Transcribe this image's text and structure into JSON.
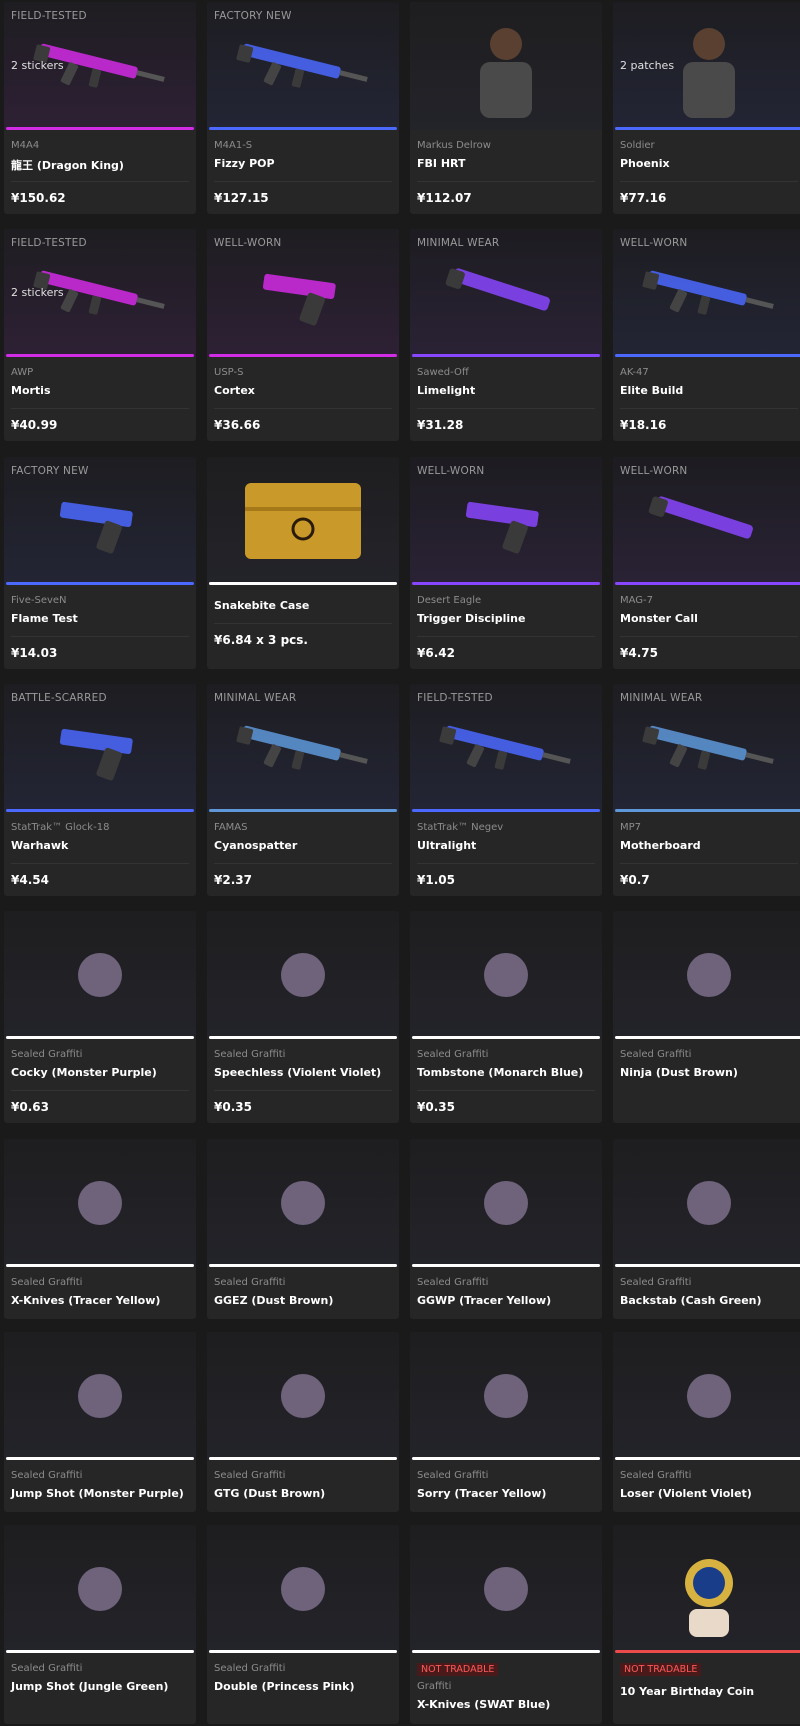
{
  "colors": {
    "pink": "#d32ce6",
    "purple": "#8847ff",
    "blue": "#4b69ff",
    "light_blue": "#5e98d9",
    "white": "#ffffff",
    "red": "#eb4b4b"
  },
  "items": [
    {
      "wear": "FIELD-TESTED",
      "extra": "2 stickers",
      "type": "M4A4",
      "name": "龍王 (Dragon King)",
      "price": "¥150.62",
      "rarity_color": "pink",
      "icon": "rifle-icon"
    },
    {
      "wear": "FACTORY NEW",
      "extra": "",
      "type": "M4A1-S",
      "name": "Fizzy POP",
      "price": "¥127.15",
      "rarity_color": "blue",
      "icon": "rifle-icon"
    },
    {
      "wear": "",
      "extra": "",
      "type": "Markus Delrow",
      "name": "FBI HRT",
      "price": "¥112.07",
      "rarity_color": "none",
      "icon": "agent-icon"
    },
    {
      "wear": "",
      "extra": "2 patches",
      "type": "Soldier",
      "name": "Phoenix",
      "price": "¥77.16",
      "rarity_color": "blue",
      "icon": "agent-icon"
    },
    {
      "wear": "FIELD-TESTED",
      "extra": "2 stickers",
      "type": "AWP",
      "name": "Mortis",
      "price": "¥40.99",
      "rarity_color": "pink",
      "icon": "sniper-icon"
    },
    {
      "wear": "WELL-WORN",
      "extra": "",
      "type": "USP-S",
      "name": "Cortex",
      "price": "¥36.66",
      "rarity_color": "pink",
      "icon": "pistol-icon"
    },
    {
      "wear": "MINIMAL WEAR",
      "extra": "",
      "type": "Sawed-Off",
      "name": "Limelight",
      "price": "¥31.28",
      "rarity_color": "purple",
      "icon": "shotgun-icon"
    },
    {
      "wear": "WELL-WORN",
      "extra": "",
      "type": "AK-47",
      "name": "Elite Build",
      "price": "¥18.16",
      "rarity_color": "blue",
      "icon": "rifle-icon"
    },
    {
      "wear": "FACTORY NEW",
      "extra": "",
      "type": "Five-SeveN",
      "name": "Flame Test",
      "price": "¥14.03",
      "rarity_color": "blue",
      "icon": "pistol-icon"
    },
    {
      "wear": "",
      "extra": "",
      "type": "",
      "name": "Snakebite Case",
      "price": "¥6.84 x 3 pcs.",
      "rarity_color": "white",
      "icon": "case-icon"
    },
    {
      "wear": "WELL-WORN",
      "extra": "",
      "type": "Desert Eagle",
      "name": "Trigger Discipline",
      "price": "¥6.42",
      "rarity_color": "purple",
      "icon": "pistol-icon"
    },
    {
      "wear": "WELL-WORN",
      "extra": "",
      "type": "MAG-7",
      "name": "Monster Call",
      "price": "¥4.75",
      "rarity_color": "purple",
      "icon": "shotgun-icon"
    },
    {
      "wear": "BATTLE-SCARRED",
      "extra": "",
      "type": "StatTrak™ Glock-18",
      "name": "Warhawk",
      "price": "¥4.54",
      "rarity_color": "blue",
      "icon": "pistol-icon"
    },
    {
      "wear": "MINIMAL WEAR",
      "extra": "",
      "type": "FAMAS",
      "name": "Cyanospatter",
      "price": "¥2.37",
      "rarity_color": "light_blue",
      "icon": "rifle-icon"
    },
    {
      "wear": "FIELD-TESTED",
      "extra": "",
      "type": "StatTrak™ Negev",
      "name": "Ultralight",
      "price": "¥1.05",
      "rarity_color": "blue",
      "icon": "machinegun-icon"
    },
    {
      "wear": "MINIMAL WEAR",
      "extra": "",
      "type": "MP7",
      "name": "Motherboard",
      "price": "¥0.7",
      "rarity_color": "light_blue",
      "icon": "smg-icon"
    },
    {
      "wear": "",
      "extra": "",
      "type": "Sealed Graffiti",
      "name": "Cocky (Monster Purple)",
      "price": "¥0.63",
      "rarity_color": "white",
      "icon": "graffiti-icon"
    },
    {
      "wear": "",
      "extra": "",
      "type": "Sealed Graffiti",
      "name": "Speechless (Violent Violet)",
      "price": "¥0.35",
      "rarity_color": "white",
      "icon": "graffiti-icon"
    },
    {
      "wear": "",
      "extra": "",
      "type": "Sealed Graffiti",
      "name": "Tombstone (Monarch Blue)",
      "price": "¥0.35",
      "rarity_color": "white",
      "icon": "graffiti-icon"
    },
    {
      "wear": "",
      "extra": "",
      "type": "Sealed Graffiti",
      "name": "Ninja (Dust Brown)",
      "price": "",
      "rarity_color": "white",
      "icon": "graffiti-icon"
    },
    {
      "wear": "",
      "extra": "",
      "type": "Sealed Graffiti",
      "name": "X-Knives (Tracer Yellow)",
      "price": "",
      "rarity_color": "white",
      "icon": "graffiti-icon"
    },
    {
      "wear": "",
      "extra": "",
      "type": "Sealed Graffiti",
      "name": "GGEZ (Dust Brown)",
      "price": "",
      "rarity_color": "white",
      "icon": "graffiti-icon"
    },
    {
      "wear": "",
      "extra": "",
      "type": "Sealed Graffiti",
      "name": "GGWP (Tracer Yellow)",
      "price": "",
      "rarity_color": "white",
      "icon": "graffiti-icon"
    },
    {
      "wear": "",
      "extra": "",
      "type": "Sealed Graffiti",
      "name": "Backstab (Cash Green)",
      "price": "",
      "rarity_color": "white",
      "icon": "graffiti-icon"
    },
    {
      "wear": "",
      "extra": "",
      "type": "Sealed Graffiti",
      "name": "Jump Shot (Monster Purple)",
      "price": "",
      "rarity_color": "white",
      "icon": "graffiti-icon"
    },
    {
      "wear": "",
      "extra": "",
      "type": "Sealed Graffiti",
      "name": "GTG (Dust Brown)",
      "price": "",
      "rarity_color": "white",
      "icon": "graffiti-icon"
    },
    {
      "wear": "",
      "extra": "",
      "type": "Sealed Graffiti",
      "name": "Sorry (Tracer Yellow)",
      "price": "",
      "rarity_color": "white",
      "icon": "graffiti-icon"
    },
    {
      "wear": "",
      "extra": "",
      "type": "Sealed Graffiti",
      "name": "Loser (Violent Violet)",
      "price": "",
      "rarity_color": "white",
      "icon": "graffiti-icon"
    },
    {
      "wear": "",
      "extra": "",
      "type": "Sealed Graffiti",
      "name": "Jump Shot (Jungle Green)",
      "price": "",
      "rarity_color": "white",
      "icon": "graffiti-icon"
    },
    {
      "wear": "",
      "extra": "",
      "type": "Sealed Graffiti",
      "name": "Double (Princess Pink)",
      "price": "",
      "rarity_color": "white",
      "icon": "graffiti-icon"
    },
    {
      "wear": "",
      "extra": "",
      "badge": "NOT TRADABLE",
      "type": "Graffiti",
      "name": "X-Knives (SWAT Blue)",
      "price": "",
      "rarity_color": "white",
      "icon": "graffiti-icon"
    },
    {
      "wear": "",
      "extra": "",
      "badge": "NOT TRADABLE",
      "type": "",
      "name": "10 Year Birthday Coin",
      "price": "",
      "rarity_color": "red",
      "icon": "coin-icon"
    }
  ]
}
